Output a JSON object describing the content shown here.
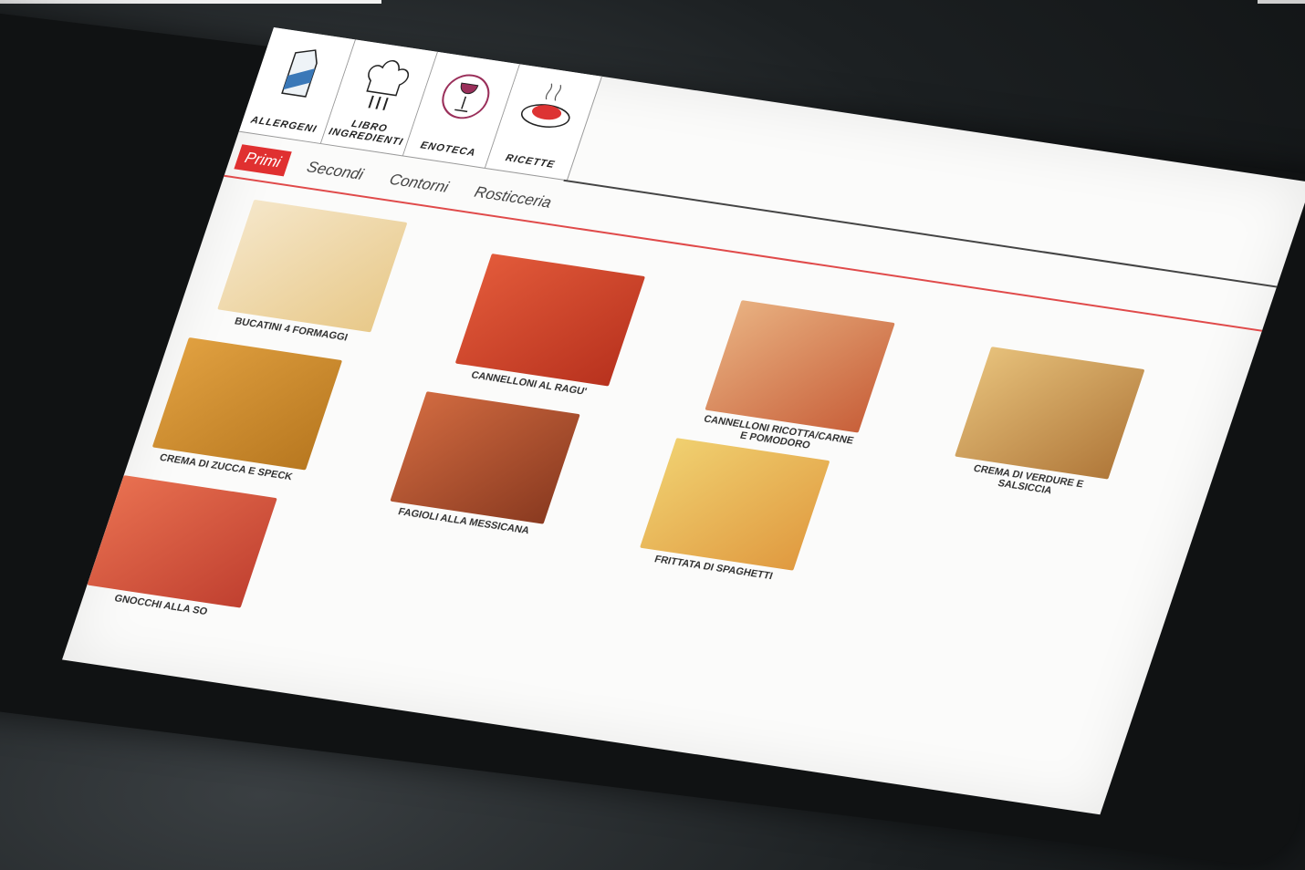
{
  "toolbar": {
    "items": [
      {
        "label": "ALLERGENI",
        "icon": "allergen-carton-icon"
      },
      {
        "label": "LIBRO INGREDIENTI",
        "icon": "chef-hat-icon"
      },
      {
        "label": "ENOTECA",
        "icon": "wine-glass-icon"
      },
      {
        "label": "RICETTE",
        "icon": "pasta-plate-icon"
      }
    ]
  },
  "tabs": {
    "items": [
      {
        "label": "Primi",
        "active": true
      },
      {
        "label": "Secondi",
        "active": false
      },
      {
        "label": "Contorni",
        "active": false
      },
      {
        "label": "Rosticceria",
        "active": false
      }
    ]
  },
  "menu": {
    "items": [
      {
        "name": "BUCATINI 4 FORMAGGI"
      },
      {
        "name": "CANNELLONI AL RAGU'"
      },
      {
        "name": "CANNELLONI RICOTTA/CARNE E POMODORO"
      },
      {
        "name": "CREMA DI VERDURE E SALSICCIA"
      },
      {
        "name": "CREMA DI ZUCCA E SPECK"
      },
      {
        "name": "FAGIOLI ALLA MESSICANA"
      },
      {
        "name": "FRITTATA DI SPAGHETTI"
      },
      {
        "name": "GNOCCHI ALLA SO"
      }
    ]
  },
  "colors": {
    "accent": "#e03030",
    "divider": "#e04a4a"
  }
}
